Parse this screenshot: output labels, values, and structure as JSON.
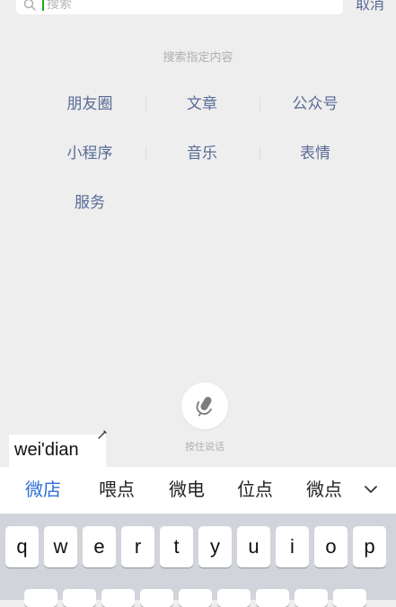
{
  "search": {
    "placeholder": "搜索",
    "cancel_label": "取消"
  },
  "specified": {
    "title": "搜索指定内容",
    "categories": [
      "朋友圈",
      "文章",
      "公众号",
      "小程序",
      "音乐",
      "表情",
      "服务"
    ]
  },
  "voice": {
    "hold_label": "按住说话"
  },
  "ime": {
    "pinyin": "wei'dian",
    "candidates": [
      "微店",
      "喂点",
      "微电",
      "位点",
      "微点"
    ],
    "selected_index": 0,
    "expand_icon": "chevron-down-icon"
  },
  "keyboard": {
    "row1": [
      "q",
      "w",
      "e",
      "r",
      "t",
      "y",
      "u",
      "i",
      "o",
      "p"
    ]
  },
  "colors": {
    "link": "#576b95",
    "candidate_selected": "#2f6fd6",
    "cursor": "#1aad19",
    "background": "#efeeee",
    "keyboard": "#d1d4da"
  }
}
